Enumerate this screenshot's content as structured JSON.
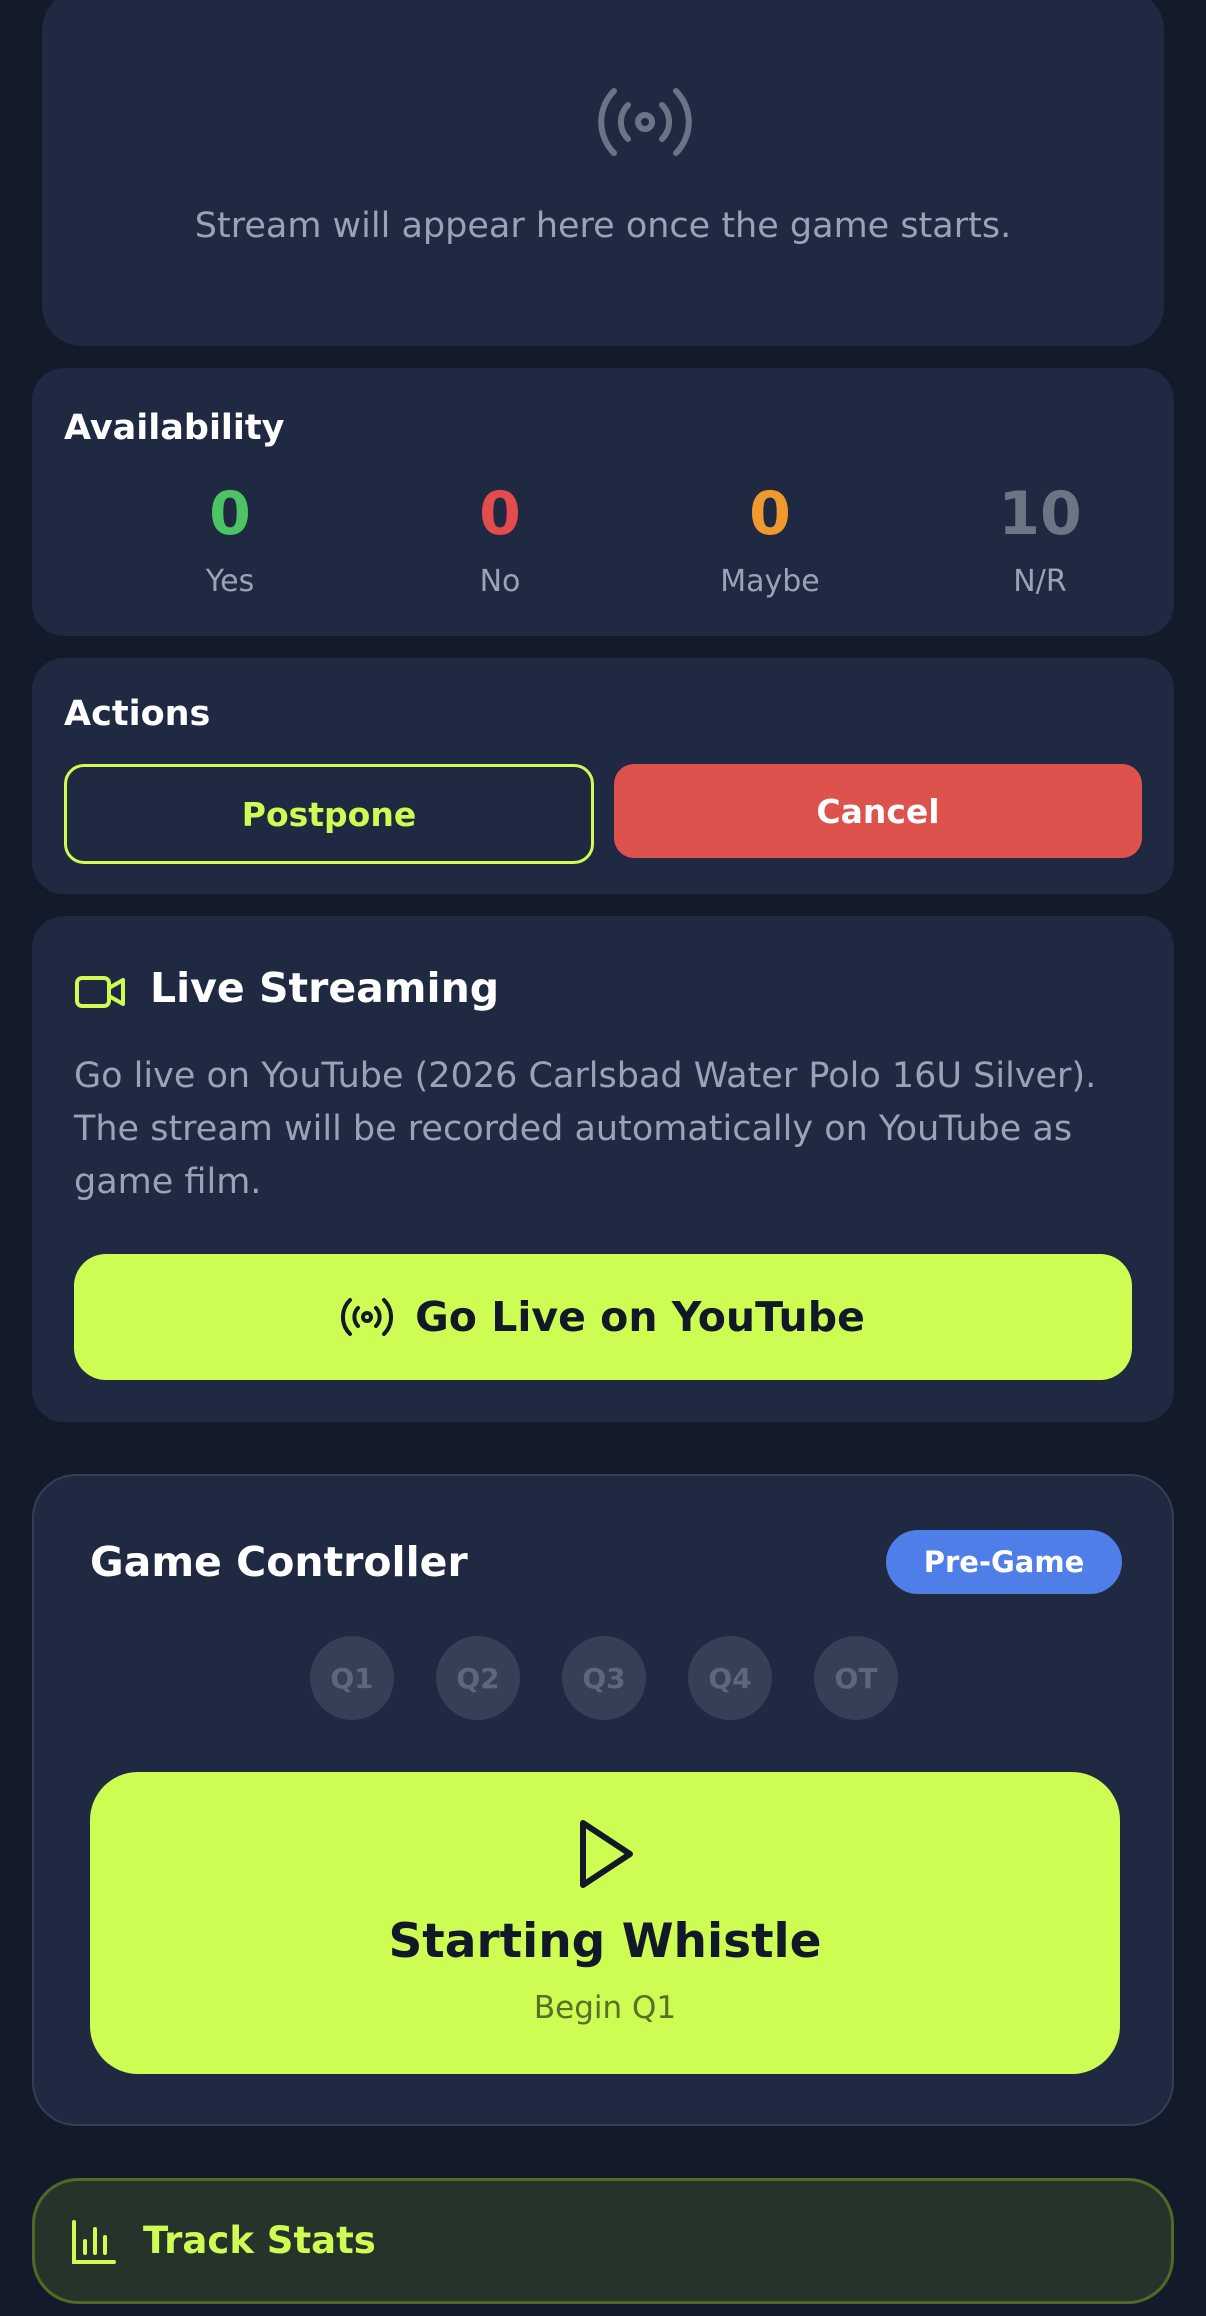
{
  "stream_placeholder": {
    "icon": "broadcast-icon",
    "message": "Stream will appear here once the game starts."
  },
  "availability": {
    "title": "Availability",
    "stats": [
      {
        "value": "0",
        "label": "Yes",
        "color": "#4cc466"
      },
      {
        "value": "0",
        "label": "No",
        "color": "#e34c4c"
      },
      {
        "value": "0",
        "label": "Maybe",
        "color": "#f09a2e"
      },
      {
        "value": "10",
        "label": "N/R",
        "color": "#6d7585"
      }
    ]
  },
  "actions": {
    "title": "Actions",
    "postpone_label": "Postpone",
    "cancel_label": "Cancel"
  },
  "live_streaming": {
    "icon": "video-camera-icon",
    "title": "Live Streaming",
    "description": "Go live on YouTube (2026 Carlsbad Water Polo 16U Silver). The stream will be recorded automatically on YouTube as game film.",
    "button_icon": "broadcast-icon",
    "button_label": "Go Live on YouTube"
  },
  "game_controller": {
    "title": "Game Controller",
    "status_badge": "Pre-Game",
    "quarters": [
      "Q1",
      "Q2",
      "Q3",
      "Q4",
      "OT"
    ],
    "start_button": {
      "icon": "play-icon",
      "title": "Starting Whistle",
      "subtitle": "Begin Q1"
    }
  },
  "track_stats": {
    "icon": "bar-chart-icon",
    "label": "Track Stats"
  },
  "colors": {
    "background": "#131b2b",
    "card": "#1f2a42",
    "accent": "#cdfc53",
    "danger": "#de524e",
    "badge": "#4f7ee8",
    "muted_text": "#9aa3b4"
  }
}
